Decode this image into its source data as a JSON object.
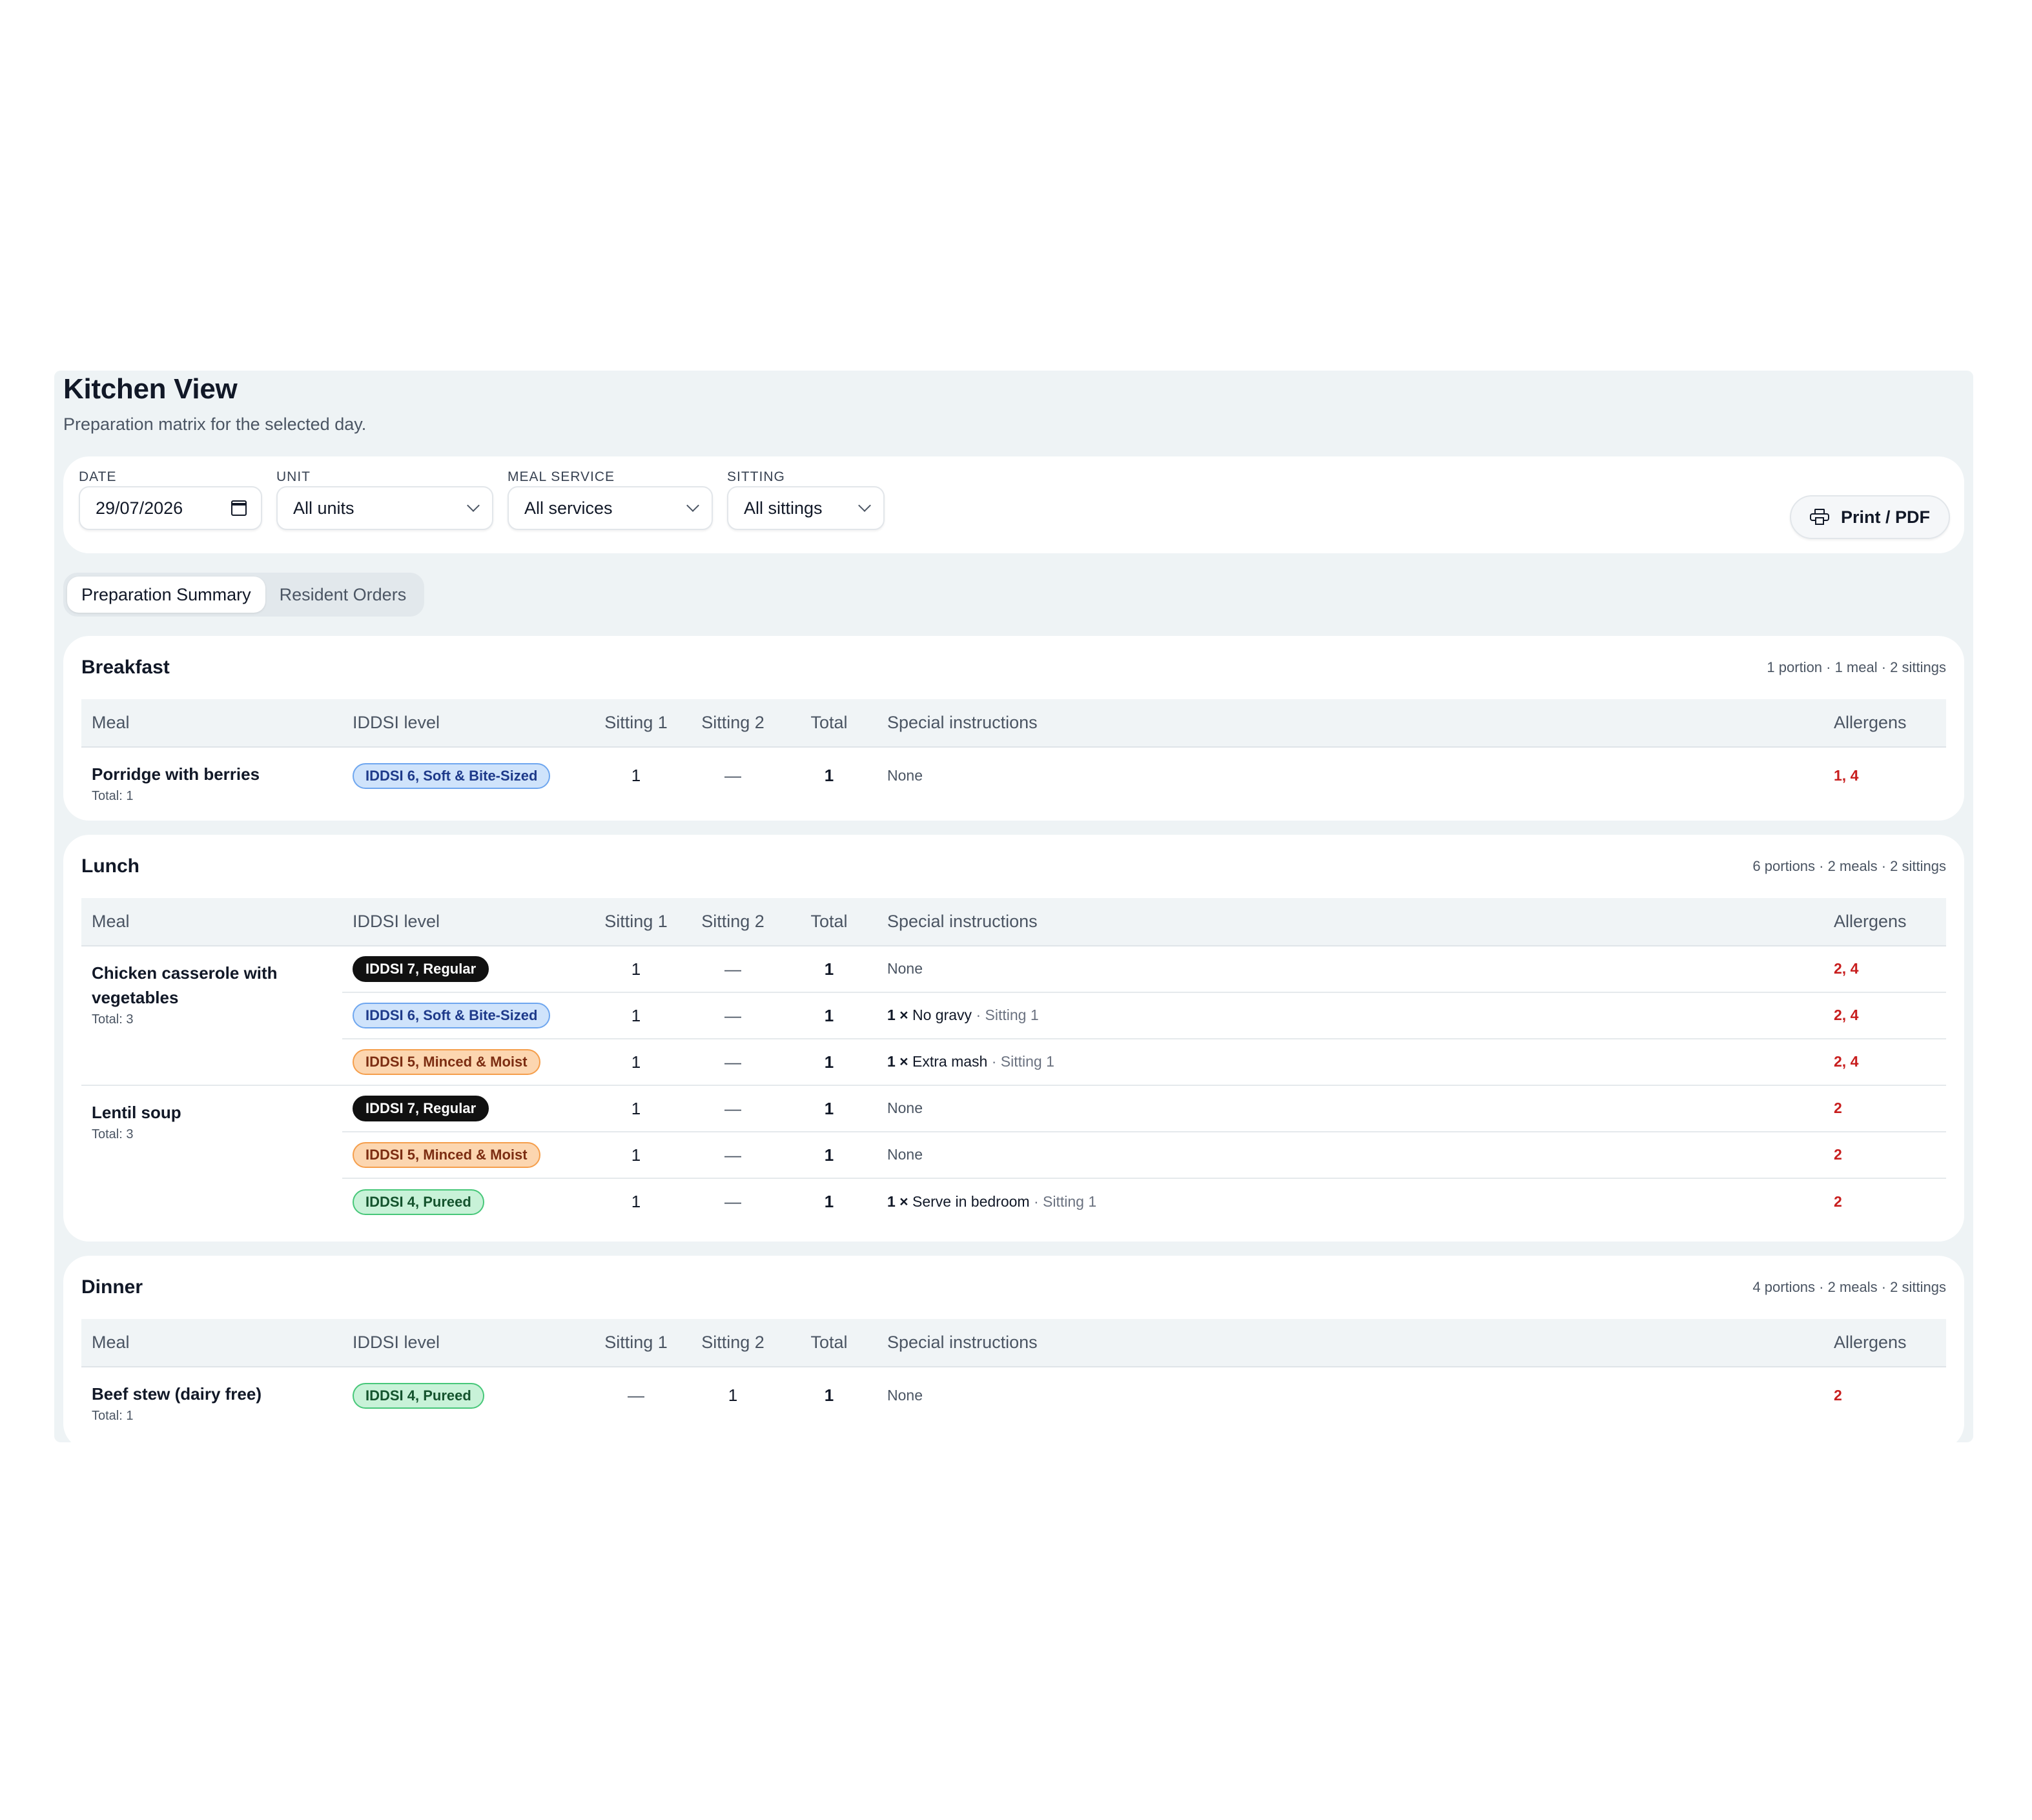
{
  "page": {
    "title": "Kitchen View",
    "subtitle": "Preparation matrix for the selected day."
  },
  "filters": {
    "date": {
      "label": "DATE",
      "value": "29/07/2026"
    },
    "unit": {
      "label": "UNIT",
      "value": "All units"
    },
    "meal_service": {
      "label": "MEAL SERVICE",
      "value": "All services"
    },
    "sitting": {
      "label": "SITTING",
      "value": "All sittings"
    },
    "print_label": "Print / PDF"
  },
  "tabs": [
    "Preparation Summary",
    "Resident Orders"
  ],
  "active_tab": "Preparation Summary",
  "columns": [
    "Meal",
    "IDDSI level",
    "Sitting 1",
    "Sitting 2",
    "Total",
    "Special instructions",
    "Allergens"
  ],
  "sections": [
    {
      "title": "Breakfast",
      "meta": "1 portion · 1 meal · 2 sittings",
      "meals": [
        {
          "name": "Porridge with berries",
          "total": "Total: 1",
          "rows": [
            {
              "iddsi": "IDDSI 6, Soft & Bite-Sized",
              "level": 6,
              "s1": "1",
              "s2": "—",
              "total": "1",
              "qty": "",
              "instr": "None",
              "sitting": "",
              "allergens": "1, 4"
            }
          ]
        }
      ]
    },
    {
      "title": "Lunch",
      "meta": "6 portions · 2 meals · 2 sittings",
      "meals": [
        {
          "name": "Chicken casserole with vegetables",
          "total": "Total: 3",
          "rows": [
            {
              "iddsi": "IDDSI 7, Regular",
              "level": 7,
              "s1": "1",
              "s2": "—",
              "total": "1",
              "qty": "",
              "instr": "None",
              "sitting": "",
              "allergens": "2, 4"
            },
            {
              "iddsi": "IDDSI 6, Soft & Bite-Sized",
              "level": 6,
              "s1": "1",
              "s2": "—",
              "total": "1",
              "qty": "1 ×",
              "instr": "No gravy",
              "sitting": "· Sitting 1",
              "allergens": "2, 4"
            },
            {
              "iddsi": "IDDSI 5, Minced & Moist",
              "level": 5,
              "s1": "1",
              "s2": "—",
              "total": "1",
              "qty": "1 ×",
              "instr": "Extra mash",
              "sitting": "· Sitting 1",
              "allergens": "2, 4"
            }
          ]
        },
        {
          "name": "Lentil soup",
          "total": "Total: 3",
          "rows": [
            {
              "iddsi": "IDDSI 7, Regular",
              "level": 7,
              "s1": "1",
              "s2": "—",
              "total": "1",
              "qty": "",
              "instr": "None",
              "sitting": "",
              "allergens": "2"
            },
            {
              "iddsi": "IDDSI 5, Minced & Moist",
              "level": 5,
              "s1": "1",
              "s2": "—",
              "total": "1",
              "qty": "",
              "instr": "None",
              "sitting": "",
              "allergens": "2"
            },
            {
              "iddsi": "IDDSI 4, Pureed",
              "level": 4,
              "s1": "1",
              "s2": "—",
              "total": "1",
              "qty": "1 ×",
              "instr": "Serve in bedroom",
              "sitting": "· Sitting 1",
              "allergens": "2"
            }
          ]
        }
      ]
    },
    {
      "title": "Dinner",
      "meta": "4 portions · 2 meals · 2 sittings",
      "meals": [
        {
          "name": "Beef stew (dairy free)",
          "total": "Total: 1",
          "rows": [
            {
              "iddsi": "IDDSI 4, Pureed",
              "level": 4,
              "s1": "—",
              "s2": "1",
              "total": "1",
              "qty": "",
              "instr": "None",
              "sitting": "",
              "allergens": "2"
            }
          ]
        }
      ]
    }
  ]
}
